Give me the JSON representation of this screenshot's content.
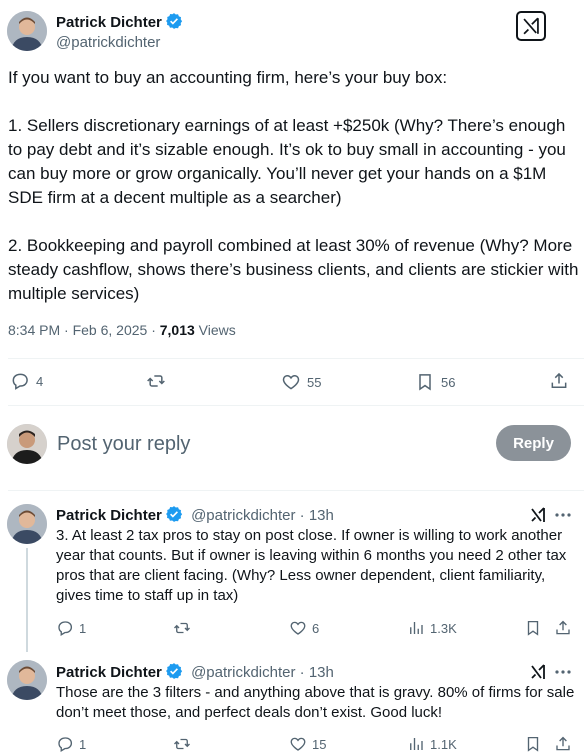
{
  "main_tweet": {
    "author_name": "Patrick Dichter",
    "author_handle": "@patrickdichter",
    "body": "If you want to buy an accounting firm, here’s your buy box:\n\n1. Sellers discretionary earnings of at least +$250k (Why? There’s enough to pay debt and it’s sizable enough. It’s ok to buy small in accounting - you can buy more or grow organically. You’ll never get your hands on a $1M SDE firm at a decent multiple as a searcher)\n\n2. Bookkeeping and payroll combined at least 30% of revenue (Why? More steady cashflow, shows there’s business clients, and clients are stickier with multiple services)",
    "time": "8:34 PM · Feb 6, 2025 · ",
    "views": "7,013",
    "views_label": " Views",
    "replies": "4",
    "reposts": "",
    "likes": "55",
    "bookmarks": "56"
  },
  "composer": {
    "placeholder": "Post your reply",
    "button_label": "Reply"
  },
  "replies": [
    {
      "author_name": "Patrick Dichter",
      "author_handle": "@patrickdichter",
      "time": " · 13h",
      "body": "3. At least 2 tax pros to stay on post close. If owner is willing to work another year that counts. But if owner is leaving within 6 months you need 2 other tax pros that are client facing. (Why? Less owner dependent, client familiarity, gives time to staff up in tax)",
      "replies": "1",
      "likes": "6",
      "views": "1.3K"
    },
    {
      "author_name": "Patrick Dichter",
      "author_handle": "@patrickdichter",
      "time": " · 13h",
      "body": "Those are the 3 filters - and anything above that is gravy. 80% of firms for sale don’t meet those, and perfect deals don’t exist. Good luck!",
      "replies": "1",
      "likes": "15",
      "views": "1.1K"
    }
  ],
  "colors": {
    "verified": "#1d9bf0",
    "muted_text": "#536471",
    "reply_button": "#8b9299"
  },
  "icons": [
    "verified-badge-icon",
    "grok-icon",
    "reply-icon",
    "repost-icon",
    "like-icon",
    "bookmark-icon",
    "share-icon",
    "views-icon",
    "more-icon"
  ]
}
